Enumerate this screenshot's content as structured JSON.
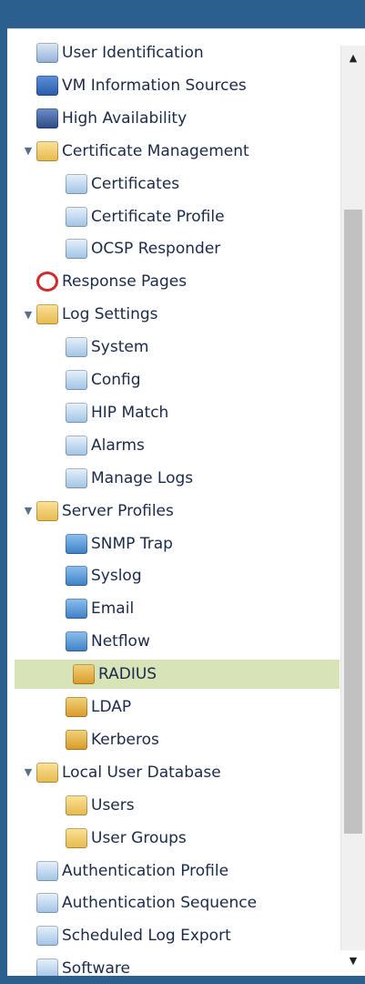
{
  "tree": {
    "items": [
      {
        "label": "User Identification",
        "icon": "user-id-icon",
        "level": 1,
        "toggle": ""
      },
      {
        "label": "VM Information Sources",
        "icon": "vm-monitor-icon",
        "level": 1,
        "toggle": ""
      },
      {
        "label": "High Availability",
        "icon": "network-icon",
        "level": 1,
        "toggle": ""
      },
      {
        "label": "Certificate Management",
        "icon": "certificate-folder-icon",
        "level": 1,
        "toggle": "▼"
      },
      {
        "label": "Certificates",
        "icon": "certificate-icon",
        "level": 2,
        "toggle": ""
      },
      {
        "label": "Certificate Profile",
        "icon": "certificate-profile-icon",
        "level": 2,
        "toggle": ""
      },
      {
        "label": "OCSP Responder",
        "icon": "ocsp-icon",
        "level": 2,
        "toggle": ""
      },
      {
        "label": "Response Pages",
        "icon": "response-pages-icon",
        "level": 1,
        "toggle": ""
      },
      {
        "label": "Log Settings",
        "icon": "log-settings-folder-icon",
        "level": 1,
        "toggle": "▼"
      },
      {
        "label": "System",
        "icon": "system-log-icon",
        "level": 2,
        "toggle": ""
      },
      {
        "label": "Config",
        "icon": "config-log-icon",
        "level": 2,
        "toggle": ""
      },
      {
        "label": "HIP Match",
        "icon": "hip-match-icon",
        "level": 2,
        "toggle": ""
      },
      {
        "label": "Alarms",
        "icon": "alarms-icon",
        "level": 2,
        "toggle": ""
      },
      {
        "label": "Manage Logs",
        "icon": "manage-logs-icon",
        "level": 2,
        "toggle": ""
      },
      {
        "label": "Server Profiles",
        "icon": "server-profiles-folder-icon",
        "level": 1,
        "toggle": "▼"
      },
      {
        "label": "SNMP Trap",
        "icon": "snmp-trap-icon",
        "level": 2,
        "toggle": ""
      },
      {
        "label": "Syslog",
        "icon": "syslog-icon",
        "level": 2,
        "toggle": ""
      },
      {
        "label": "Email",
        "icon": "email-icon",
        "level": 2,
        "toggle": ""
      },
      {
        "label": "Netflow",
        "icon": "netflow-icon",
        "level": 2,
        "toggle": ""
      },
      {
        "label": "RADIUS",
        "icon": "radius-icon",
        "level": 2,
        "toggle": "",
        "selected": true
      },
      {
        "label": "LDAP",
        "icon": "ldap-icon",
        "level": 2,
        "toggle": ""
      },
      {
        "label": "Kerberos",
        "icon": "kerberos-icon",
        "level": 2,
        "toggle": ""
      },
      {
        "label": "Local User Database",
        "icon": "local-user-db-folder-icon",
        "level": 1,
        "toggle": "▼"
      },
      {
        "label": "Users",
        "icon": "users-icon",
        "level": 2,
        "toggle": ""
      },
      {
        "label": "User Groups",
        "icon": "user-groups-icon",
        "level": 2,
        "toggle": ""
      },
      {
        "label": "Authentication Profile",
        "icon": "authentication-profile-icon",
        "level": 1,
        "toggle": ""
      },
      {
        "label": "Authentication Sequence",
        "icon": "authentication-sequence-icon",
        "level": 1,
        "toggle": ""
      },
      {
        "label": "Scheduled Log Export",
        "icon": "scheduled-log-export-icon",
        "level": 1,
        "toggle": ""
      },
      {
        "label": "Software",
        "icon": "software-icon",
        "level": 1,
        "toggle": ""
      }
    ]
  },
  "scrollbar": {
    "up": "▲",
    "down": "▼"
  },
  "colors": {
    "frame": "#2b5f8e",
    "selected_row": "#d9e3b8",
    "text": "#1a2a4a"
  }
}
